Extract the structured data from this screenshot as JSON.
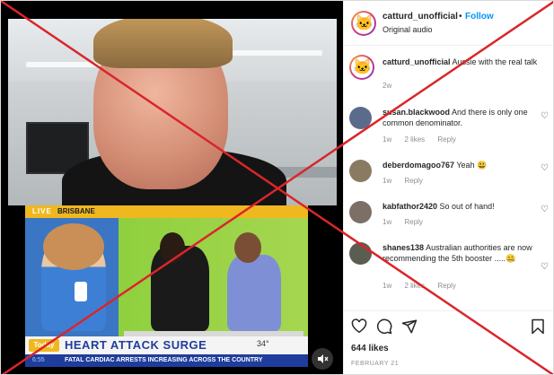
{
  "post": {
    "username": "catturd_unofficial",
    "separator": "•",
    "follow_label": "Follow",
    "audio": "Original audio",
    "caption_user": "catturd_unofficial",
    "caption_text": "Aussie with the real talk",
    "caption_age": "2w",
    "likes": "644 likes",
    "date": "FEBRUARY 21"
  },
  "video": {
    "live_label": "LIVE",
    "location": "BRISBANE",
    "brand": "Today",
    "headline": "HEART ATTACK SURGE",
    "subheadline": "FATAL CARDIAC ARRESTS INCREASING ACROSS THE COUNTRY",
    "time": "6:55",
    "weather": "34°",
    "mute_icon": "speaker-muted-icon"
  },
  "comments": [
    {
      "user": "susan.blackwood",
      "text": "And there is only one common denominator.",
      "age": "1w",
      "likes": "2 likes",
      "reply": "Reply",
      "avatar_color": "#5b6b8c"
    },
    {
      "user": "deberdomagoo767",
      "text": "Yeah 😃",
      "age": "1w",
      "likes": "",
      "reply": "Reply",
      "avatar_color": "#8a7a62"
    },
    {
      "user": "kabfathor2420",
      "text": "So out of hand!",
      "age": "1w",
      "likes": "",
      "reply": "Reply",
      "avatar_color": "#7b6f66"
    },
    {
      "user": "shanes138",
      "text": "Australian authorities are now recommending the 5th booster .....🤐",
      "age": "1w",
      "likes": "2 likes",
      "reply": "Reply",
      "avatar_color": "#5a5d4f"
    }
  ],
  "actions": {
    "like_icon": "heart-icon",
    "comment_icon": "comment-icon",
    "share_icon": "share-icon",
    "save_icon": "bookmark-icon"
  },
  "colors": {
    "follow": "#0095f6",
    "overlay_x": "#d9262b",
    "muted_text": "#8e8e8e"
  }
}
